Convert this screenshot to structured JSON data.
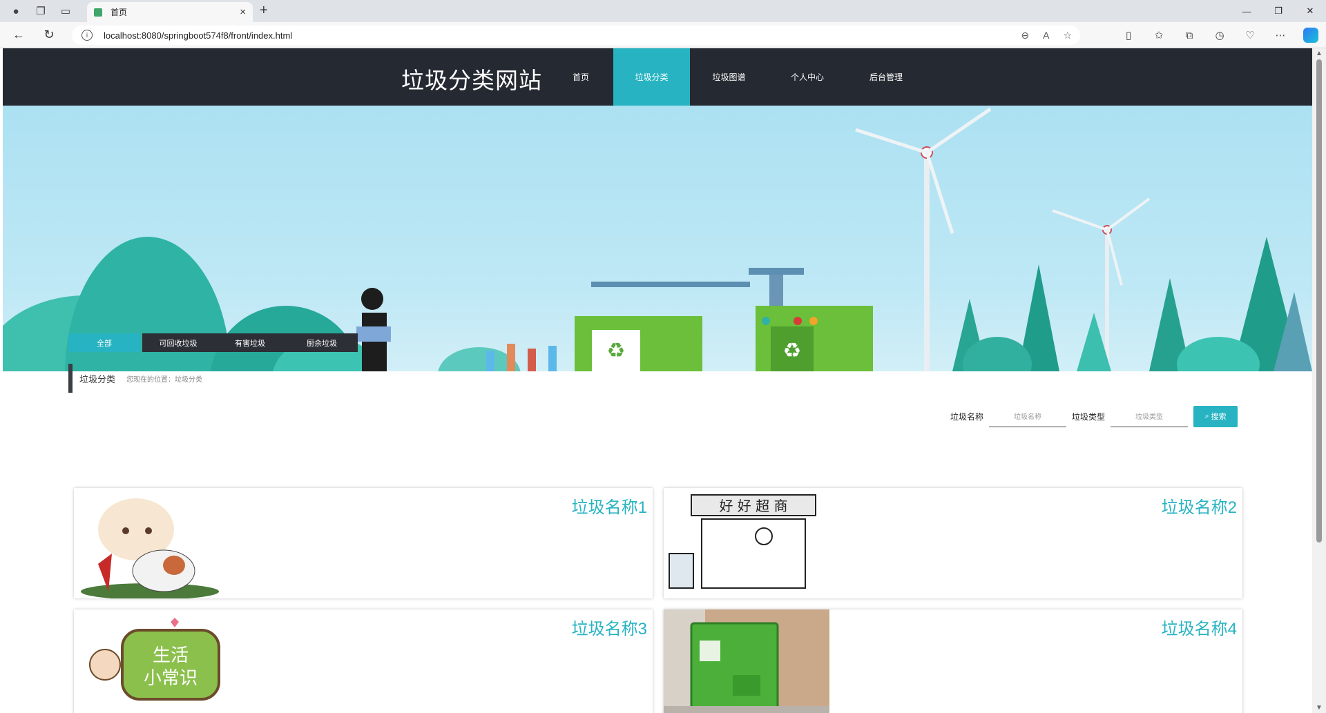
{
  "browser": {
    "tab_title": "首页",
    "url": "localhost:8080/springboot574f8/front/index.html"
  },
  "header": {
    "site_title": "垃圾分类网站",
    "menu": [
      {
        "label": "首页",
        "active": false
      },
      {
        "label": "垃圾分类",
        "active": true
      },
      {
        "label": "垃圾图谱",
        "active": false
      },
      {
        "label": "个人中心",
        "active": false
      },
      {
        "label": "后台管理",
        "active": false
      }
    ]
  },
  "category_tabs": [
    {
      "label": "全部",
      "active": true
    },
    {
      "label": "可回收垃圾",
      "active": false
    },
    {
      "label": "有害垃圾",
      "active": false
    },
    {
      "label": "厨余垃圾",
      "active": false
    }
  ],
  "breadcrumb": {
    "title": "垃圾分类",
    "position": "您现在的位置：垃圾分类"
  },
  "search": {
    "name_label": "垃圾名称",
    "name_placeholder": "垃圾名称",
    "type_label": "垃圾类型",
    "type_placeholder": "垃圾类型",
    "button_label": "搜索"
  },
  "items": [
    {
      "name": "垃圾名称1"
    },
    {
      "name": "垃圾名称2"
    },
    {
      "name": "垃圾名称3"
    },
    {
      "name": "垃圾名称4"
    }
  ],
  "colors": {
    "accent": "#27b3c2",
    "header_bg": "#252931"
  }
}
